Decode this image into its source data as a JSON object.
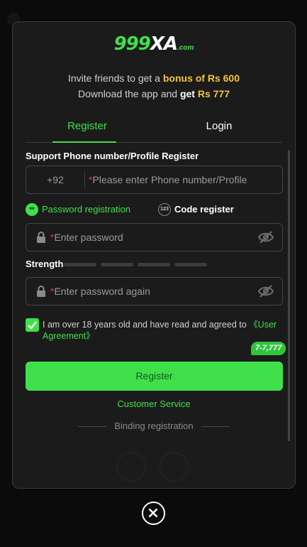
{
  "logo": {
    "brand_left": "999",
    "brand_right": "XA",
    "domain": ".com"
  },
  "promo": {
    "line1_prefix": "Invite friends to get a ",
    "line1_highlight": "bonus of Rs 600",
    "line2_prefix": "Download the app and ",
    "line2_get": "get ",
    "line2_highlight": "Rs 777"
  },
  "tabs": [
    {
      "label": "Register",
      "active": true
    },
    {
      "label": "Login",
      "active": false
    }
  ],
  "form": {
    "section_label": "Support Phone number/Profile Register",
    "phone_prefix": "+92",
    "required_mark": "*",
    "phone_placeholder": "Please enter Phone number/Profile",
    "option_password": "Password registration",
    "option_password_icon": "**",
    "option_code": "Code register",
    "option_code_icon": "123",
    "password_placeholder": "Enter password",
    "strength_label": "Strength",
    "password_again_placeholder": "Enter password again",
    "agree_text": "I am over 18 years old and have read and agreed to ",
    "agree_link": "《User Agreement》",
    "agree_checked": true,
    "bonus_bubble": "7-7,777",
    "register_button": "Register",
    "customer_service": "Customer Service",
    "binding_registration": "Binding registration"
  },
  "colors": {
    "accent": "#3fe04a",
    "highlight": "#f4c430",
    "background": "#1b1b1b",
    "required": "#e03a3a"
  },
  "icons": [
    "lock-icon",
    "eye-off-icon",
    "check-icon",
    "close-icon"
  ]
}
